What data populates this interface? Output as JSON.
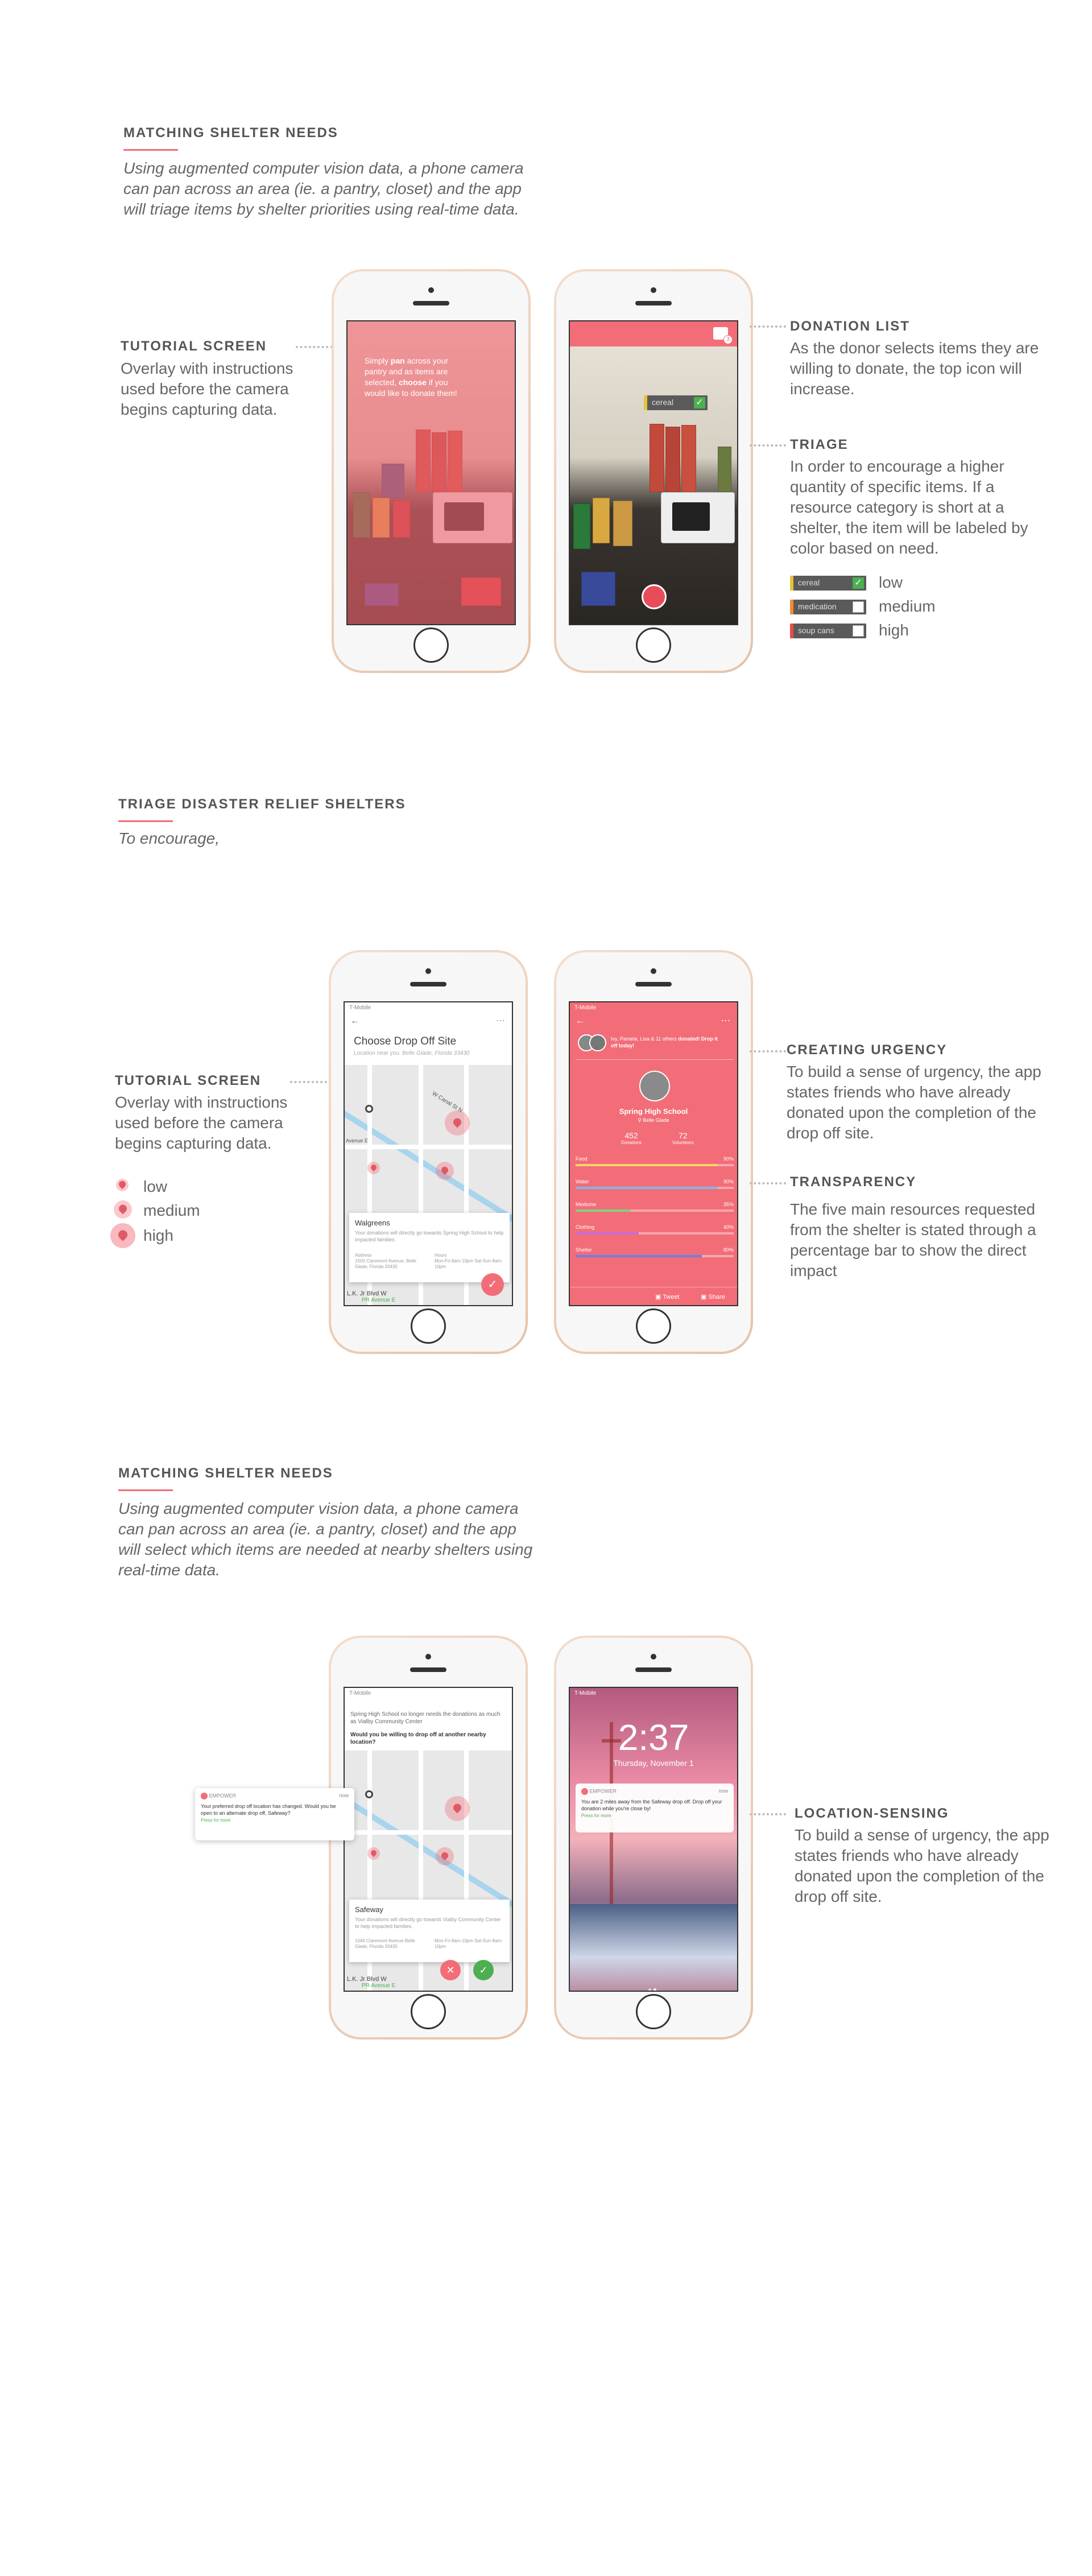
{
  "section1": {
    "title": "MATCHING SHELTER NEEDS",
    "desc": "Using augmented computer vision data, a phone camera can pan across an area (ie. a pantry, closet) and the app will triage items by shelter priorities using real-time data.",
    "tutorial": {
      "title": "TUTORIAL SCREEN",
      "body": "Overlay with instructions used before the camera begins capturing data."
    },
    "donation": {
      "title": "DONATION LIST",
      "body": "As the donor selects items they are willing to donate, the top icon will increase."
    },
    "triage": {
      "title": "TRIAGE",
      "body": "In order to encourage a higher quantity of specific items. If a resource category is short at a shelter, the item will be labeled by color based on need."
    },
    "overlay_text_a": "Simply ",
    "overlay_text_b": "pan",
    "overlay_text_c": " across your pantry and as items are selected, ",
    "overlay_text_d": "choose",
    "overlay_text_e": " if you would like to donate them!",
    "cereal_chip": "cereal",
    "legend": [
      {
        "chip": "cereal",
        "label": "low",
        "color": "#e8c23a"
      },
      {
        "chip": "medication",
        "label": "medium",
        "color": "#f28c38"
      },
      {
        "chip": "soup cans",
        "label": "high",
        "color": "#e84b4b"
      }
    ],
    "badge_count": "3"
  },
  "section2": {
    "title": "TRIAGE DISASTER RELIEF SHELTERS",
    "desc": "To encourage,",
    "tutorial": {
      "title": "TUTORIAL SCREEN",
      "body": "Overlay with instructions used before the camera begins capturing data."
    },
    "legend": [
      "low",
      "medium",
      "high"
    ],
    "urgency": {
      "title": "CREATING URGENCY",
      "body": "To build a sense of urgency, the app states friends who have already donated upon the completion of the drop off site."
    },
    "transparency": {
      "title": "TRANSPARENCY",
      "body": "The five main resources requested from the shelter is stated through a percentage bar to show the direct impact"
    },
    "map_screen": {
      "status": "T-Mobile",
      "title": "Choose Drop Off Site",
      "location_label": "Location near you:",
      "location": "Belle Glade, Florida 33430",
      "street1": "W Canal St N",
      "street2": "Avenue E",
      "card_title": "Walgreens",
      "card_body": "Your donations will directly go towards Spring High School to help impacted families.",
      "card_addr_label": "Address",
      "card_addr": "1500 Claremont Avenue, Belle Glade, Florida 33430",
      "card_hours_label": "Hours",
      "card_hours": "Mon-Fri 8am-10pm Sat-Sun 8am-10pm",
      "bottom_street": "L.K. Jr Blvd W",
      "bottom_street2": "PR Avenue E"
    },
    "profile_screen": {
      "status": "T-Mobile",
      "friends_text_a": "Ivy, Pamela, Lisa & 11 others ",
      "friends_text_b": "donated",
      "friends_text_c": "! Drop it off today!",
      "school": "Spring High School",
      "place": "Belle Glade",
      "stat1_value": "452",
      "stat1_label": "Donations",
      "stat2_value": "72",
      "stat2_label": "Volunteers",
      "resources": [
        {
          "name": "Food",
          "pct": 90,
          "label": "90%",
          "color": "#f7d36b"
        },
        {
          "name": "Water",
          "pct": 90,
          "label": "90%",
          "color": "#7fb7e6"
        },
        {
          "name": "Medicine",
          "pct": 35,
          "label": "35%",
          "color": "#7ed37f"
        },
        {
          "name": "Clothing",
          "pct": 40,
          "label": "40%",
          "color": "#c86bd9"
        },
        {
          "name": "Shelter",
          "pct": 80,
          "label": "80%",
          "color": "#6b7fe6"
        }
      ],
      "tweet": "Tweet",
      "share": "Share"
    }
  },
  "section3": {
    "title": "MATCHING SHELTER NEEDS",
    "desc": "Using augmented computer vision data, a phone camera can pan across an area (ie. a pantry, closet) and the app will select which items are needed at nearby shelters using real-time data.",
    "location": {
      "title": "LOCATION-SENSING",
      "body": "To build a sense of urgency, the app states friends who have already donated upon the completion of the drop off site."
    },
    "alt_screen": {
      "status": "T-Mobile",
      "msg": "Spring High School no longer needs the donations as much as Vialby Community Center",
      "question": "Would you be willing to drop off at another nearby location?",
      "card_title": "Safeway",
      "card_body": "Your donations will directly go towards Vialby Community Center to help impacted families.",
      "card_addr": "1040 Claremont Avenue Belle Glade, Florida 33430",
      "card_hours": "Mon-Fri 8am-10pm Sat-Sun 8am-10pm",
      "bottom_street": "L.K. Jr Blvd W",
      "bottom_street2": "PR Avenue E"
    },
    "popup": {
      "app": "EMPOWER",
      "time": "now",
      "body": "Your preferred drop off location has changed. Would you be open to an alternate drop off, Safeway?",
      "more": "Press for more"
    },
    "lock_screen": {
      "status": "T-Mobile",
      "time": "2:37",
      "date": "Thursday, November 1",
      "app": "EMPOWER",
      "ago": "now",
      "body": "You are 2 miles away from the Safeway drop off. Drop off your donation while you're close by!",
      "more": "Press for more"
    }
  }
}
